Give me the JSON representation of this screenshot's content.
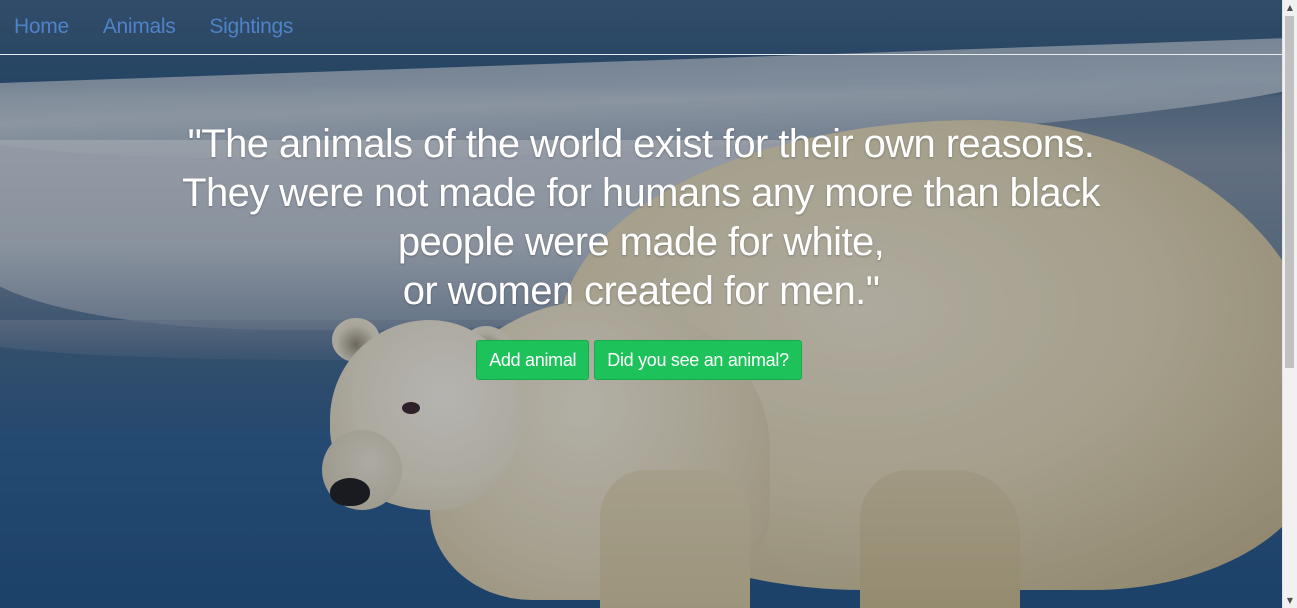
{
  "nav": {
    "items": [
      {
        "label": "Home"
      },
      {
        "label": "Animals"
      },
      {
        "label": "Sightings"
      }
    ]
  },
  "hero": {
    "quote_lines": [
      "\"The animals of the world exist for their own reasons.",
      "They were not made for humans any more than black",
      "people were made for white,",
      "or women created for men.\""
    ],
    "buttons": {
      "add_animal": "Add animal",
      "saw_animal": "Did you see an animal?"
    }
  },
  "background": {
    "subject": "polar-bear-on-ice"
  },
  "colors": {
    "nav_link": "#4f83c8",
    "button_bg": "#1dc35a",
    "text": "#ffffff"
  },
  "scrollbar": {
    "up_icon": "arrow-up-icon",
    "down_icon": "arrow-down-icon"
  }
}
